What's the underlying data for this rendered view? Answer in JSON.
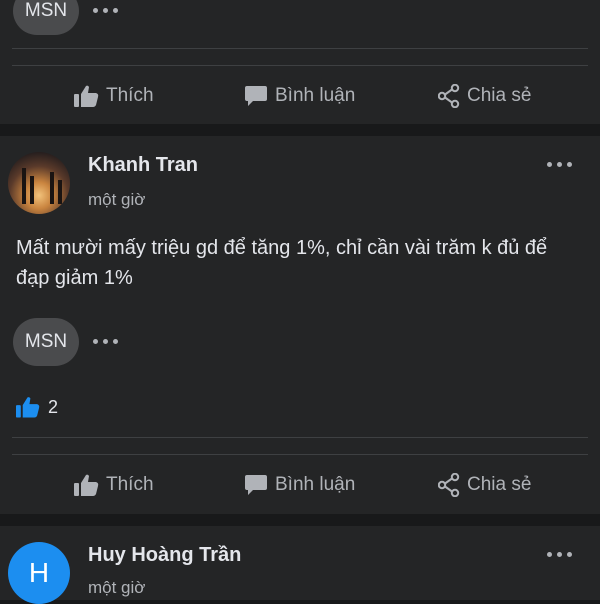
{
  "post_top": {
    "reaction_label": "MSN"
  },
  "actions": {
    "like": "Thích",
    "comment": "Bình luận",
    "share": "Chia sẻ"
  },
  "post_main": {
    "author": "Khanh Tran",
    "time": "một giờ",
    "text": "Mất mười mấy triệu gd để tăng 1%, chỉ cần vài trăm k đủ để đạp giảm 1%",
    "reaction_label": "MSN",
    "like_count": "2"
  },
  "post_next": {
    "author": "Huy Hoàng Trần",
    "avatar_letter": "H",
    "time": "một giờ"
  },
  "colors": {
    "background": "#18191a",
    "card": "#242526",
    "accent_blue": "#1c8ef0",
    "muted_text": "#b0b3b8"
  }
}
